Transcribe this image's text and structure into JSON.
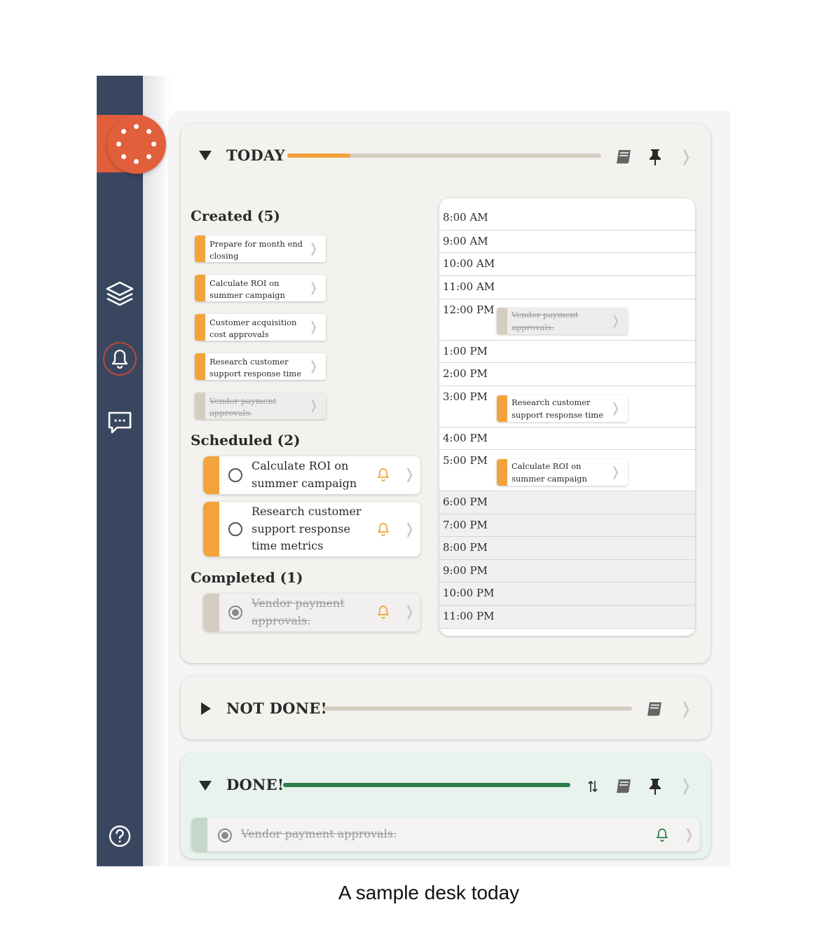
{
  "sidebar": {
    "logo_icon": "dotted-circle-logo",
    "icons": [
      "layers-icon",
      "bell-icon",
      "chat-icon",
      "help-icon"
    ]
  },
  "today": {
    "title": "TODAY",
    "progress": 0.2,
    "created": {
      "title": "Created (5)",
      "tasks": [
        {
          "label": "Prepare for month end closing",
          "completed": false
        },
        {
          "label": "Calculate ROI on summer campaign",
          "completed": false
        },
        {
          "label": "Customer acquisition cost approvals",
          "completed": false
        },
        {
          "label": "Research customer support response time",
          "completed": false
        },
        {
          "label": "Vendor payment approvals.",
          "completed": true
        }
      ]
    },
    "scheduled": {
      "title": "Scheduled (2)",
      "tasks": [
        {
          "label": "Calculate ROI on summer campaign"
        },
        {
          "label": "Research customer support response time metrics"
        }
      ]
    },
    "completed": {
      "title": "Completed (1)",
      "tasks": [
        {
          "label": "Vendor payment approvals."
        }
      ]
    },
    "calendar": {
      "times": [
        "8:00 AM",
        "9:00 AM",
        "10:00 AM",
        "11:00 AM",
        "12:00 PM",
        "1:00 PM",
        "2:00 PM",
        "3:00 PM",
        "4:00 PM",
        "5:00 PM",
        "6:00 PM",
        "7:00 PM",
        "8:00 PM",
        "9:00 PM",
        "10:00 PM",
        "11:00 PM"
      ],
      "events": [
        {
          "label": "Vendor payment approvals.",
          "completed": true
        },
        {
          "label": "Research customer support response time",
          "completed": false
        },
        {
          "label": "Calculate ROI on summer campaign",
          "completed": false
        }
      ]
    }
  },
  "not_done": {
    "title": "NOT DONE!",
    "progress": 0
  },
  "done": {
    "title": "DONE!",
    "progress": 1,
    "tasks": [
      {
        "label": "Vendor payment approvals."
      }
    ]
  },
  "caption": "A sample desk today",
  "colors": {
    "sidebar": "#394660",
    "accent": "#e25f3c",
    "task_bar": "#f2a33b",
    "done_progress": "#2e7d4a"
  }
}
